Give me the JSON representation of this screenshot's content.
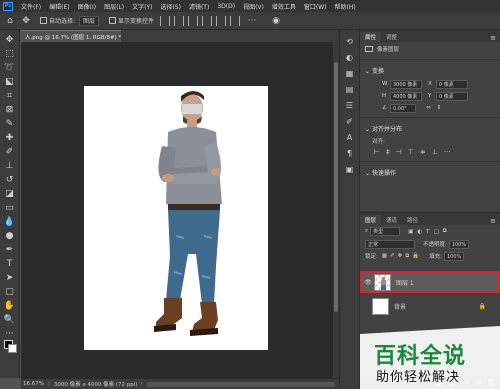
{
  "menu": [
    "文件(F)",
    "编辑(E)",
    "图像(I)",
    "图层(L)",
    "文字(Y)",
    "选择(S)",
    "滤镜(T)",
    "3D(D)",
    "视图(V)",
    "增效工具",
    "窗口(W)",
    "帮助(H)"
  ],
  "app_logo": "Ps",
  "options": {
    "auto_select": "自动选择:",
    "auto_select_value": "图层",
    "show_transform": "显示变换控件"
  },
  "doc_tab": "人.png @ 16.7% (图层 1, RGB/8#) *",
  "status": {
    "zoom": "16.67%",
    "info": "3000 像素 x 4000 像素 (72 ppi)"
  },
  "properties": {
    "tabs": [
      "属性",
      "调整"
    ],
    "layer_kind": "像素图层",
    "transform_title": "变换",
    "w_label": "W",
    "w_value": "3000 像素",
    "h_label": "H",
    "h_value": "4000 像素",
    "x_label": "X",
    "x_value": "0 像素",
    "y_label": "Y",
    "y_value": "0 像素",
    "angle": "0.00°",
    "align_title": "对齐并分布",
    "align_sub": "对齐:",
    "quick_title": "快速操作"
  },
  "layers": {
    "tabs": [
      "图层",
      "通道",
      "路径"
    ],
    "filter": "类型",
    "blend": "正常",
    "opacity_label": "不透明度:",
    "opacity_value": "100%",
    "lock_label": "锁定:",
    "fill_label": "填充:",
    "fill_value": "100%",
    "items": [
      {
        "name": "图层 1"
      },
      {
        "name": "背景"
      }
    ]
  },
  "watermark": {
    "title": "百科全说",
    "subtitle": "助你轻松解决"
  },
  "colors": {
    "highlight": "#e5202e",
    "accent_green": "#1a8a3a"
  }
}
